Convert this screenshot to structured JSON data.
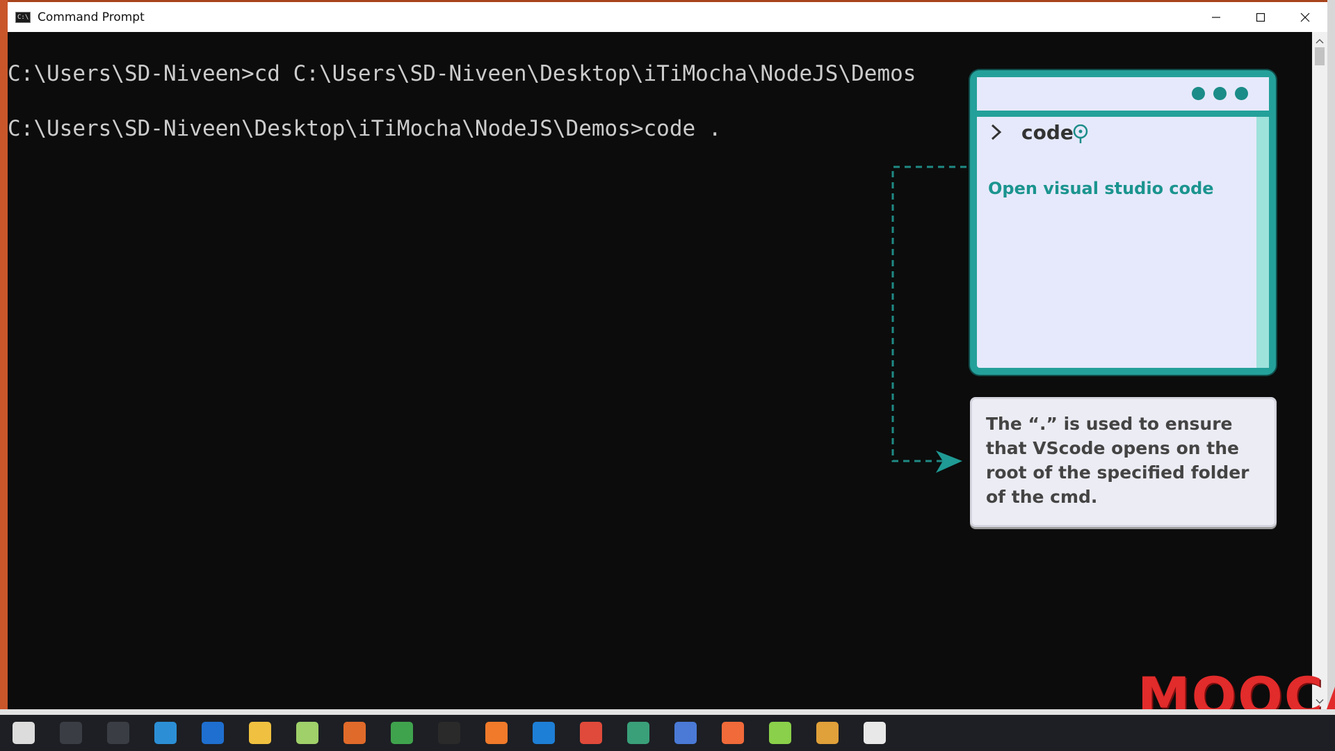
{
  "window": {
    "title": "Command Prompt",
    "app_icon_text": "C:\\",
    "buttons": [
      "minimize",
      "maximize",
      "close"
    ]
  },
  "terminal": {
    "lines": [
      "C:\\Users\\SD-Niveen>cd C:\\Users\\SD-Niveen\\Desktop\\iTiMocha\\NodeJS\\Demos",
      "C:\\Users\\SD-Niveen\\Desktop\\iTiMocha\\NodeJS\\Demos>code ."
    ]
  },
  "illustration": {
    "command": "code",
    "caption": "Open visual studio code",
    "note": "The “.” is used to ensure that VScode opens on the root of the specified folder of the cmd.",
    "accent_color": "#24a09a"
  },
  "logo": {
    "text": "MOOCA"
  },
  "taskbar": {
    "icons": [
      {
        "name": "start-icon",
        "color": "#dcdcdc"
      },
      {
        "name": "search-icon",
        "color": "#3a3d44"
      },
      {
        "name": "task-view-icon",
        "color": "#3a3d44"
      },
      {
        "name": "edge-icon",
        "color": "#2c8fd6"
      },
      {
        "name": "browser-icon",
        "color": "#1f6fd0"
      },
      {
        "name": "file-explorer-icon",
        "color": "#f0c040"
      },
      {
        "name": "notepad-icon",
        "color": "#9fd06a"
      },
      {
        "name": "office-icon",
        "color": "#e06a2a"
      },
      {
        "name": "chrome-icon",
        "color": "#3fa34d"
      },
      {
        "name": "cmd-icon",
        "color": "#2a2a2a"
      },
      {
        "name": "firefox-icon",
        "color": "#f07a2a"
      },
      {
        "name": "vscode-icon",
        "color": "#1e7fd6"
      },
      {
        "name": "app-red-icon",
        "color": "#e04a3a"
      },
      {
        "name": "app-green-icon",
        "color": "#3aa07a"
      },
      {
        "name": "app-blue-icon",
        "color": "#4a7ad6"
      },
      {
        "name": "app-orange-icon",
        "color": "#f06a3a"
      },
      {
        "name": "app-lime-icon",
        "color": "#8ad04a"
      },
      {
        "name": "app-chrome2-icon",
        "color": "#e0a03a"
      },
      {
        "name": "app-white-icon",
        "color": "#e8e8e8"
      }
    ]
  }
}
